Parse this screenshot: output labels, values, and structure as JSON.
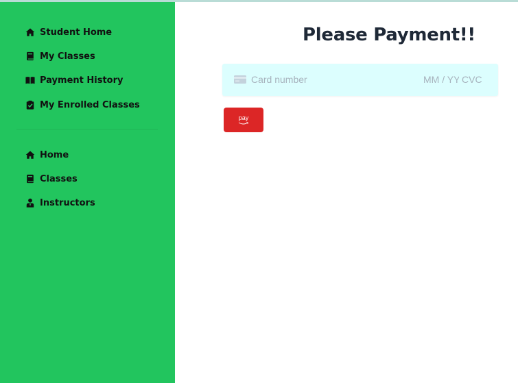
{
  "sidebar": {
    "student_items": [
      {
        "label": "Student Home",
        "icon": "home-icon"
      },
      {
        "label": "My Classes",
        "icon": "book-icon"
      },
      {
        "label": "Payment History",
        "icon": "open-book-icon"
      },
      {
        "label": "My Enrolled Classes",
        "icon": "clipboard-check-icon"
      }
    ],
    "main_items": [
      {
        "label": "Home",
        "icon": "home-icon"
      },
      {
        "label": "Classes",
        "icon": "book-icon"
      },
      {
        "label": "Instructors",
        "icon": "user-tie-icon"
      }
    ],
    "background_color": "#22c55e"
  },
  "main": {
    "title": "Please Payment!!",
    "card_form": {
      "card_number_placeholder": "Card number",
      "expiry_placeholder": "MM / YY",
      "cvc_placeholder": "CVC",
      "background_color": "#dcfefe"
    },
    "pay_button": {
      "label": "pay",
      "color": "#dc2626"
    }
  }
}
